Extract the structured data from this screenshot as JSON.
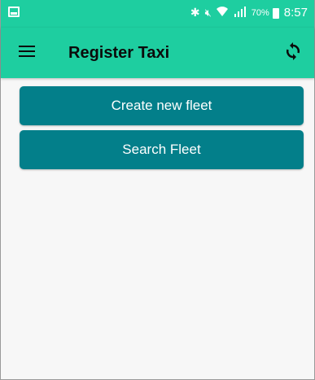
{
  "status_bar": {
    "battery_percent": "70%",
    "time": "8:57",
    "icons": [
      "notification-icon",
      "bluetooth-icon",
      "mute-icon",
      "wifi-icon",
      "signal-icon",
      "battery-icon"
    ]
  },
  "app_bar": {
    "title": "Register Taxi",
    "menu_icon": "hamburger-menu-icon",
    "refresh_icon": "refresh-icon"
  },
  "main": {
    "buttons": [
      {
        "label": "Create new fleet"
      },
      {
        "label": "Search Fleet"
      }
    ]
  },
  "colors": {
    "accent": "#1ecea0",
    "button": "#037f8a",
    "background": "#f7f7f7"
  }
}
